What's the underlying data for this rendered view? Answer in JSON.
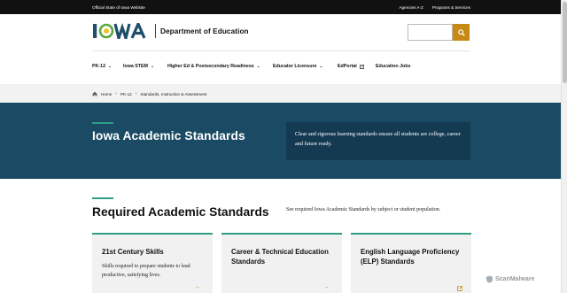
{
  "topbar": {
    "official": "Official State of Iowa Website",
    "links": [
      "Agencies A-Z",
      "Programs & Services"
    ]
  },
  "header": {
    "logo_text": "IOWA",
    "department": "Department of Education",
    "search_placeholder": "",
    "colors": {
      "brand_blue": "#1f4f6a",
      "brand_green": "#5aa83f",
      "search_button": "#c68a14"
    }
  },
  "nav": {
    "items": [
      {
        "label": "PK-12",
        "has_dropdown": true
      },
      {
        "label": "Iowa STEM",
        "has_dropdown": true
      },
      {
        "label": "Higher Ed & Postsecondary Readiness",
        "has_dropdown": true
      },
      {
        "label": "Educator Licensure",
        "has_dropdown": true
      },
      {
        "label": "EdPortal",
        "external": true
      },
      {
        "label": "Education Jobs"
      }
    ]
  },
  "breadcrumb": {
    "items": [
      "Home",
      "PK-12",
      "Standards, Instruction & Assessment"
    ]
  },
  "hero": {
    "title": "Iowa Academic Standards",
    "intro": "Clear and rigorous learning standards ensure all students are college, career and future ready.",
    "background": "#1b4a64"
  },
  "section": {
    "title": "Required Academic Standards",
    "note": "See required Iowa Academic Standards by subject or student population."
  },
  "cards": [
    {
      "title": "21st Century Skills",
      "description": "Skills required to prepare students to lead productive, satisfying lives.",
      "icon": "arrow-right-icon"
    },
    {
      "title": "Career & Technical Education Standards",
      "description": "",
      "icon": "arrow-right-icon"
    },
    {
      "title": "English Language Proficiency (ELP) Standards",
      "description": "",
      "icon": "external-link-icon"
    }
  ],
  "watermark": {
    "text": "ScanMalware"
  }
}
